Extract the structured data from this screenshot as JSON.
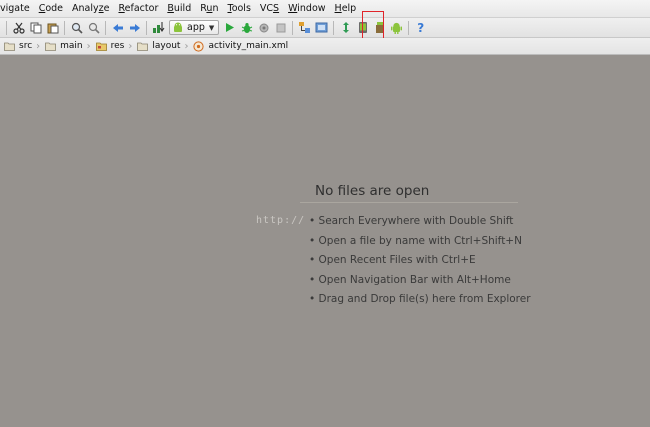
{
  "menu": [
    {
      "pre": "",
      "mn": "",
      "post": "vigate"
    },
    {
      "pre": "",
      "mn": "C",
      "post": "ode"
    },
    {
      "pre": "Analy",
      "mn": "z",
      "post": "e"
    },
    {
      "pre": "",
      "mn": "R",
      "post": "efactor"
    },
    {
      "pre": "",
      "mn": "B",
      "post": "uild"
    },
    {
      "pre": "R",
      "mn": "u",
      "post": "n"
    },
    {
      "pre": "",
      "mn": "T",
      "post": "ools"
    },
    {
      "pre": "VC",
      "mn": "S",
      "post": ""
    },
    {
      "pre": "",
      "mn": "W",
      "post": "indow"
    },
    {
      "pre": "",
      "mn": "H",
      "post": "elp"
    }
  ],
  "toolbar": {
    "run_config": "app",
    "help_symbol": "?"
  },
  "breadcrumb": [
    "src",
    "main",
    "res",
    "layout",
    "activity_main.xml"
  ],
  "editor": {
    "title": "No files are open",
    "hints": [
      "Search Everywhere with Double Shift",
      "Open a file by name with Ctrl+Shift+N",
      "Open Recent Files with Ctrl+E",
      "Open Navigation Bar with Alt+Home",
      "Drag and Drop file(s) here from Explorer"
    ],
    "watermark": "http://"
  },
  "colors": {
    "editor_bg": "#96928e",
    "highlight": "#e0242a",
    "android_green": "#8cc43c",
    "run_green": "#2aa83c"
  }
}
